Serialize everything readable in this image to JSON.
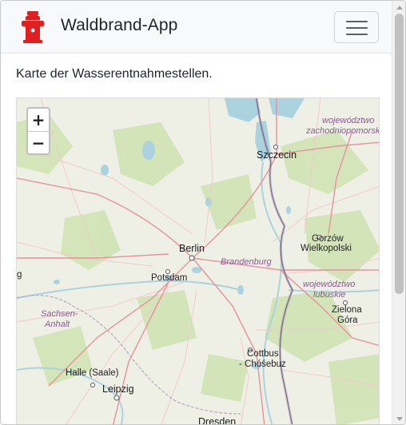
{
  "navbar": {
    "brand_title": "Waldbrand-App",
    "brand_icon": "fire-hydrant-icon",
    "toggler_icon": "hamburger-menu-icon"
  },
  "main": {
    "intro_text": "Karte der Wasserentnahmestellen."
  },
  "map": {
    "zoom_in_label": "+",
    "zoom_out_label": "−",
    "labels": {
      "szczecin": "Szczecin",
      "berlin": "Berlin",
      "potsdam": "Potsdam",
      "brandenburg": "Brandenburg",
      "wz_line1": "województwo",
      "wz_line2": "zachodniopomorsk",
      "gorzow_line1": "Gorzów",
      "gorzow_line2": "Wielkopolski",
      "wl_line1": "województwo",
      "wl_line2": "lubuskie",
      "sachsen_line1": "Sachsen-",
      "sachsen_line2": "Anhalt",
      "zielona_line1": "Zielona",
      "zielona_line2": "Góra",
      "cottbus_line1": "Cottbus",
      "cottbus_line2": "- Chóśebuz",
      "halle": "Halle (Saale)",
      "leipzig": "Leipzig",
      "dresden": "Dresden",
      "edge_g": "g"
    }
  },
  "colors": {
    "brand_red": "#e02020",
    "navbar_bg": "#f8f9fa",
    "map_land": "#eef0e6",
    "forest": "#cfe3b4",
    "water": "#aad3df",
    "border_line": "#9a8aa5"
  }
}
